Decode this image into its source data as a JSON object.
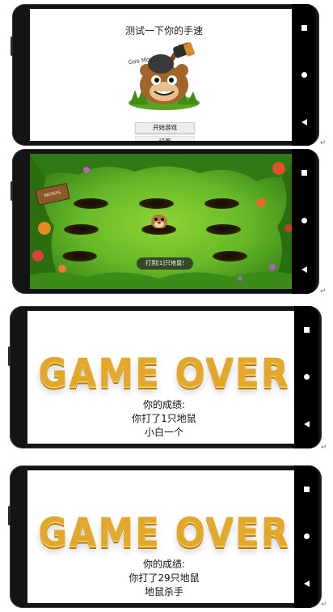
{
  "menu": {
    "title": "测试一下你的手速",
    "image_caption": "Goo Mouse",
    "start_button": "开始游戏",
    "settings_button": "设置"
  },
  "game": {
    "toast": "打到[1]只地鼠!",
    "sign_text": "ABCDEFG"
  },
  "result_1": {
    "banner": "GAME OVER",
    "score_label": "你的成绩:",
    "score_line": "你打了1只地鼠",
    "rank": "小白一个"
  },
  "result_2": {
    "banner": "GAME OVER",
    "score_label": "你的成绩:",
    "score_line": "你打了29只地鼠",
    "rank": "地鼠杀手"
  },
  "colors": {
    "phone_frame": "#141414",
    "gold": "#e3a72a",
    "grass": "#66b828"
  },
  "icons": [
    "nav-recent-icon",
    "nav-home-icon",
    "nav-back-icon",
    "pilcrow-icon"
  ]
}
